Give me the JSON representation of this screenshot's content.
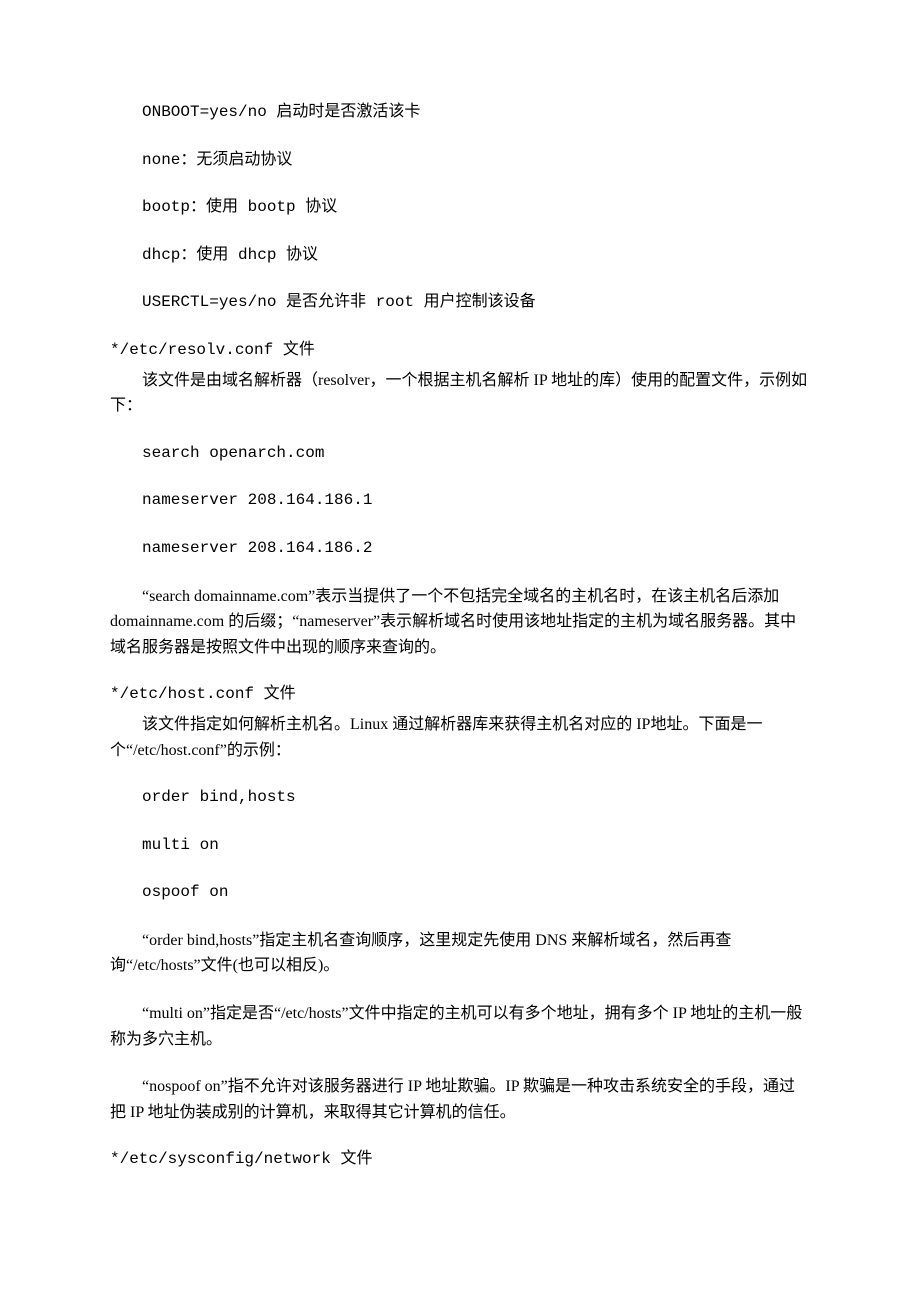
{
  "lines": {
    "l1": "ONBOOT=yes/no      启动时是否激活该卡",
    "l2": "none：无须启动协议",
    "l3": "bootp：使用 bootp 协议",
    "l4": "dhcp：使用 dhcp 协议",
    "l5": "USERCTL=yes/no               是否允许非 root 用户控制该设备"
  },
  "section1": {
    "heading": "*/etc/resolv.conf 文件",
    "body1": "该文件是由域名解析器（resolver，一个根据主机名解析 IP 地址的库）使用的配置文件，示例如下：",
    "code1": "search openarch.com",
    "code2": "nameserver 208.164.186.1",
    "code3": "nameserver 208.164.186.2",
    "body2": "“search domainname.com”表示当提供了一个不包括完全域名的主机名时，在该主机名后添加 domainname.com 的后缀；“nameserver”表示解析域名时使用该地址指定的主机为域名服务器。其中域名服务器是按照文件中出现的顺序来查询的。"
  },
  "section2": {
    "heading": "*/etc/host.conf 文件",
    "body1": "该文件指定如何解析主机名。Linux 通过解析器库来获得主机名对应的 IP地址。下面是一个“/etc/host.conf”的示例：",
    "code1": "order bind,hosts",
    "code2": "multi on",
    "code3": "ospoof on",
    "body2": "“order bind,hosts”指定主机名查询顺序，这里规定先使用 DNS 来解析域名，然后再查询“/etc/hosts”文件(也可以相反)。",
    "body3": "“multi on”指定是否“/etc/hosts”文件中指定的主机可以有多个地址，拥有多个 IP 地址的主机一般称为多穴主机。",
    "body4": "“nospoof on”指不允许对该服务器进行 IP 地址欺骗。IP 欺骗是一种攻击系统安全的手段，通过把 IP 地址伪装成别的计算机，来取得其它计算机的信任。"
  },
  "section3": {
    "heading": "*/etc/sysconfig/network 文件"
  }
}
